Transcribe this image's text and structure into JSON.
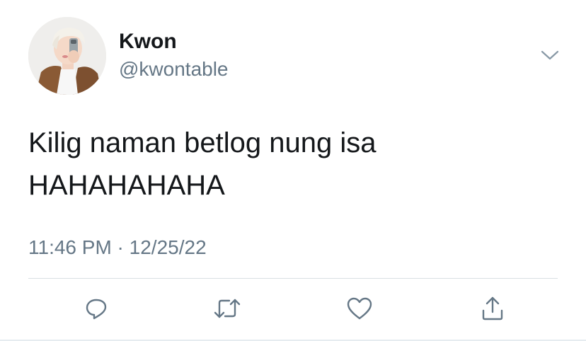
{
  "user": {
    "display_name": "Kwon",
    "handle": "@kwontable",
    "avatar_icon": "profile-photo"
  },
  "tweet": {
    "lines": [
      "Kilig naman betlog nung isa",
      "HAHAHAHAHA"
    ],
    "timestamp": "11:46 PM · 12/25/22"
  },
  "actions": [
    {
      "icon": "reply-icon"
    },
    {
      "icon": "retweet-icon"
    },
    {
      "icon": "like-icon"
    },
    {
      "icon": "share-icon"
    }
  ],
  "colors": {
    "text": "#14171a",
    "secondary": "#657786",
    "divider": "#d9dfe3",
    "icon": "#657786"
  }
}
